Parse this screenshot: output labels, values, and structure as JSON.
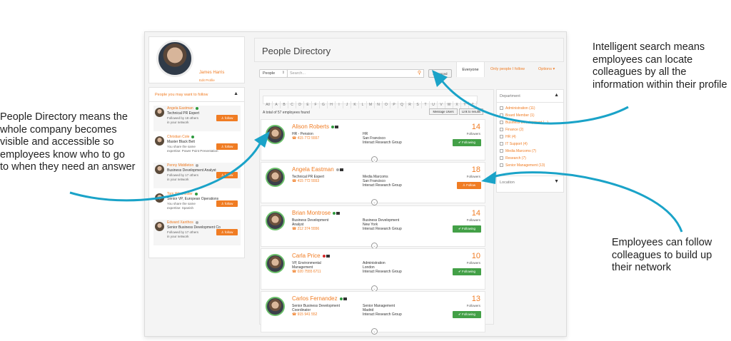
{
  "profile": {
    "name": "James Harris",
    "edit": "Edit Profile"
  },
  "suggestions": {
    "title": "People you may want to follow",
    "follow_label": "follow",
    "items": [
      {
        "name": "Angela Eastman",
        "title": "Technical PR Expert",
        "line1": "Followed by 18 others",
        "line2": "in your network",
        "status": "online"
      },
      {
        "name": "Christian Cole",
        "title": "Master Black Belt",
        "line1": "You share the same",
        "line2": "expertise: Power Point Presentation",
        "status": "online"
      },
      {
        "name": "Penny Middleton",
        "title": "Business Development Analyst",
        "line1": "Followed by 17 others",
        "line2": "in your network",
        "status": "offline"
      },
      {
        "name": "Tom Winchester",
        "title": "Senior VP, European Operations",
        "line1": "You share the same",
        "line2": "expertise: Spanish",
        "status": "online"
      },
      {
        "name": "Edward Xanthos",
        "title": "Senior Business Development Coordinator",
        "line1": "Followed by 17 others",
        "line2": "in your network",
        "status": "offline"
      }
    ]
  },
  "directory": {
    "title": "People Directory",
    "search_type": "People",
    "search_placeholder": "Search...",
    "advanced": "Advanced",
    "tabs": [
      "Everyone",
      "Only people I follow",
      "Options"
    ],
    "letters": [
      "All",
      "A",
      "B",
      "C",
      "D",
      "E",
      "F",
      "G",
      "H",
      "I",
      "J",
      "K",
      "L",
      "M",
      "N",
      "O",
      "P",
      "Q",
      "R",
      "S",
      "T",
      "U",
      "V",
      "W",
      "X",
      "Y",
      "Z"
    ],
    "total": "A total of 57 employees found",
    "btn_message": "Message Users",
    "btn_link": "Link to results",
    "followers_label": "Followers",
    "following_label": "Following",
    "follow_label": "Follow",
    "people": [
      {
        "name": "Alison Roberts",
        "role1": "HR - Pension",
        "role2": "",
        "phone": "415 772 5557",
        "dept": "HR",
        "city": "San Francisco",
        "org": "Interact Research Group",
        "count": "14",
        "state": "following",
        "status": "online"
      },
      {
        "name": "Angela Eastman",
        "role1": "Technical PR Expert",
        "role2": "",
        "phone": "415 772 5553",
        "dept": "Media Marcoms",
        "city": "San Francisco",
        "org": "Interact Research Group",
        "count": "18",
        "state": "follow",
        "status": "offline"
      },
      {
        "name": "Brian Montrose",
        "role1": "Business Development",
        "role2": "Analyst",
        "phone": "212 374 5556",
        "dept": "Business Development",
        "city": "New York",
        "org": "Interact Research Group",
        "count": "14",
        "state": "following",
        "status": "online"
      },
      {
        "name": "Carla Price",
        "role1": "VP, Environmental",
        "role2": "Management",
        "phone": "020 7555 6711",
        "dept": "Administration",
        "city": "London",
        "org": "Interact Research Group",
        "count": "10",
        "state": "following",
        "status": "busy"
      },
      {
        "name": "Carlos Fernandez",
        "role1": "Senior Business Development",
        "role2": "Coordinator",
        "phone": "915 941 552",
        "dept": "Senior Management",
        "city": "Madrid",
        "org": "Interact Research Group",
        "count": "13",
        "state": "following",
        "status": "online"
      }
    ]
  },
  "filters": {
    "department_title": "Department",
    "location_title": "Location",
    "items": [
      "Administration (11)",
      "Board Member (1)",
      "Business Development (...)",
      "Finance (2)",
      "HR (4)",
      "IT Support (4)",
      "Media Marcoms (7)",
      "Research (7)",
      "Senior Management (13)"
    ]
  },
  "annotations": {
    "left": "People Directory means the whole company becomes visible and accessible so employees know who to go to when they need an answer",
    "top_right": "Intelligent search means employees can locate colleagues by all the information within their profile",
    "bottom_right": "Employees can follow colleagues to build up their network"
  },
  "colors": {
    "accent": "#f07c23",
    "following": "#43a047",
    "arrow": "#1aa3c8"
  }
}
